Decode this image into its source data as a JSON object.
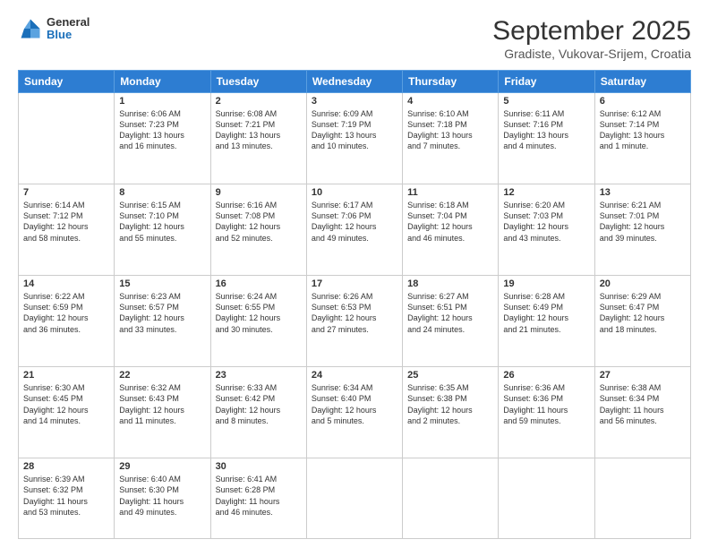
{
  "header": {
    "logo": {
      "general": "General",
      "blue": "Blue"
    },
    "title": "September 2025",
    "location": "Gradiste, Vukovar-Srijem, Croatia"
  },
  "days": [
    "Sunday",
    "Monday",
    "Tuesday",
    "Wednesday",
    "Thursday",
    "Friday",
    "Saturday"
  ],
  "weeks": [
    [
      {
        "day": "",
        "content": ""
      },
      {
        "day": "1",
        "content": "Sunrise: 6:06 AM\nSunset: 7:23 PM\nDaylight: 13 hours\nand 16 minutes."
      },
      {
        "day": "2",
        "content": "Sunrise: 6:08 AM\nSunset: 7:21 PM\nDaylight: 13 hours\nand 13 minutes."
      },
      {
        "day": "3",
        "content": "Sunrise: 6:09 AM\nSunset: 7:19 PM\nDaylight: 13 hours\nand 10 minutes."
      },
      {
        "day": "4",
        "content": "Sunrise: 6:10 AM\nSunset: 7:18 PM\nDaylight: 13 hours\nand 7 minutes."
      },
      {
        "day": "5",
        "content": "Sunrise: 6:11 AM\nSunset: 7:16 PM\nDaylight: 13 hours\nand 4 minutes."
      },
      {
        "day": "6",
        "content": "Sunrise: 6:12 AM\nSunset: 7:14 PM\nDaylight: 13 hours\nand 1 minute."
      }
    ],
    [
      {
        "day": "7",
        "content": "Sunrise: 6:14 AM\nSunset: 7:12 PM\nDaylight: 12 hours\nand 58 minutes."
      },
      {
        "day": "8",
        "content": "Sunrise: 6:15 AM\nSunset: 7:10 PM\nDaylight: 12 hours\nand 55 minutes."
      },
      {
        "day": "9",
        "content": "Sunrise: 6:16 AM\nSunset: 7:08 PM\nDaylight: 12 hours\nand 52 minutes."
      },
      {
        "day": "10",
        "content": "Sunrise: 6:17 AM\nSunset: 7:06 PM\nDaylight: 12 hours\nand 49 minutes."
      },
      {
        "day": "11",
        "content": "Sunrise: 6:18 AM\nSunset: 7:04 PM\nDaylight: 12 hours\nand 46 minutes."
      },
      {
        "day": "12",
        "content": "Sunrise: 6:20 AM\nSunset: 7:03 PM\nDaylight: 12 hours\nand 43 minutes."
      },
      {
        "day": "13",
        "content": "Sunrise: 6:21 AM\nSunset: 7:01 PM\nDaylight: 12 hours\nand 39 minutes."
      }
    ],
    [
      {
        "day": "14",
        "content": "Sunrise: 6:22 AM\nSunset: 6:59 PM\nDaylight: 12 hours\nand 36 minutes."
      },
      {
        "day": "15",
        "content": "Sunrise: 6:23 AM\nSunset: 6:57 PM\nDaylight: 12 hours\nand 33 minutes."
      },
      {
        "day": "16",
        "content": "Sunrise: 6:24 AM\nSunset: 6:55 PM\nDaylight: 12 hours\nand 30 minutes."
      },
      {
        "day": "17",
        "content": "Sunrise: 6:26 AM\nSunset: 6:53 PM\nDaylight: 12 hours\nand 27 minutes."
      },
      {
        "day": "18",
        "content": "Sunrise: 6:27 AM\nSunset: 6:51 PM\nDaylight: 12 hours\nand 24 minutes."
      },
      {
        "day": "19",
        "content": "Sunrise: 6:28 AM\nSunset: 6:49 PM\nDaylight: 12 hours\nand 21 minutes."
      },
      {
        "day": "20",
        "content": "Sunrise: 6:29 AM\nSunset: 6:47 PM\nDaylight: 12 hours\nand 18 minutes."
      }
    ],
    [
      {
        "day": "21",
        "content": "Sunrise: 6:30 AM\nSunset: 6:45 PM\nDaylight: 12 hours\nand 14 minutes."
      },
      {
        "day": "22",
        "content": "Sunrise: 6:32 AM\nSunset: 6:43 PM\nDaylight: 12 hours\nand 11 minutes."
      },
      {
        "day": "23",
        "content": "Sunrise: 6:33 AM\nSunset: 6:42 PM\nDaylight: 12 hours\nand 8 minutes."
      },
      {
        "day": "24",
        "content": "Sunrise: 6:34 AM\nSunset: 6:40 PM\nDaylight: 12 hours\nand 5 minutes."
      },
      {
        "day": "25",
        "content": "Sunrise: 6:35 AM\nSunset: 6:38 PM\nDaylight: 12 hours\nand 2 minutes."
      },
      {
        "day": "26",
        "content": "Sunrise: 6:36 AM\nSunset: 6:36 PM\nDaylight: 11 hours\nand 59 minutes."
      },
      {
        "day": "27",
        "content": "Sunrise: 6:38 AM\nSunset: 6:34 PM\nDaylight: 11 hours\nand 56 minutes."
      }
    ],
    [
      {
        "day": "28",
        "content": "Sunrise: 6:39 AM\nSunset: 6:32 PM\nDaylight: 11 hours\nand 53 minutes."
      },
      {
        "day": "29",
        "content": "Sunrise: 6:40 AM\nSunset: 6:30 PM\nDaylight: 11 hours\nand 49 minutes."
      },
      {
        "day": "30",
        "content": "Sunrise: 6:41 AM\nSunset: 6:28 PM\nDaylight: 11 hours\nand 46 minutes."
      },
      {
        "day": "",
        "content": ""
      },
      {
        "day": "",
        "content": ""
      },
      {
        "day": "",
        "content": ""
      },
      {
        "day": "",
        "content": ""
      }
    ]
  ]
}
